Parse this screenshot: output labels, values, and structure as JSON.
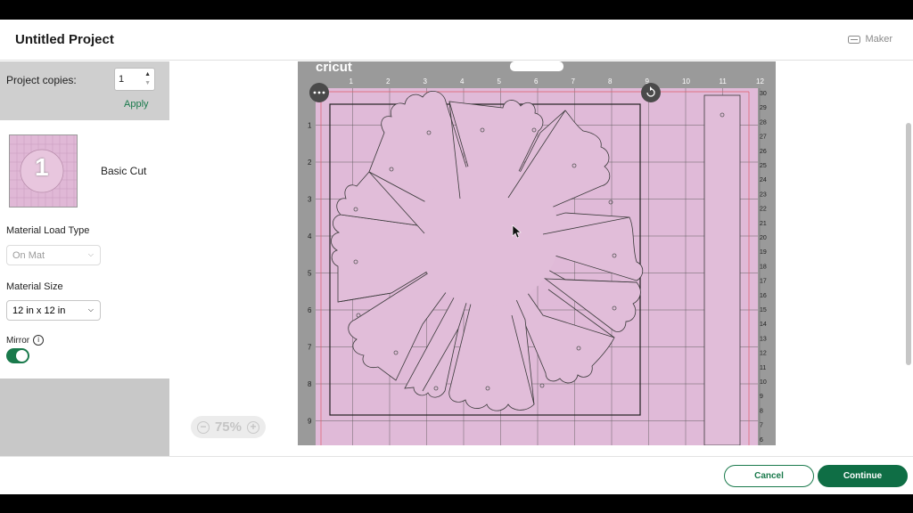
{
  "header": {
    "title": "Untitled Project",
    "device_label": "Maker"
  },
  "sidebar": {
    "copies_label": "Project copies:",
    "copies_value": "1",
    "apply_label": "Apply",
    "mat_number": "1",
    "mat_name": "Basic Cut",
    "load_type_label": "Material Load Type",
    "load_type_value": "On Mat",
    "size_label": "Material Size",
    "size_value": "12 in x 12 in",
    "mirror_label": "Mirror",
    "mirror_on": true
  },
  "mat": {
    "brand": "cricut",
    "top_ruler": [
      "1",
      "2",
      "3",
      "4",
      "5",
      "6",
      "7",
      "8",
      "9",
      "10",
      "11",
      "12"
    ],
    "left_ruler": [
      "1",
      "2",
      "3",
      "4",
      "5",
      "6",
      "7",
      "8",
      "9"
    ],
    "right_ruler": [
      "30",
      "29",
      "28",
      "27",
      "26",
      "25",
      "24",
      "23",
      "22",
      "21",
      "20",
      "19",
      "18",
      "17",
      "16",
      "15",
      "14",
      "13",
      "12",
      "11",
      "10",
      "9",
      "8",
      "7",
      "6"
    ],
    "mat_color": "#e0bad8",
    "frame_color": "#9a9a9a"
  },
  "zoom": {
    "minus": "−",
    "value": "75%",
    "plus": "+"
  },
  "footer": {
    "cancel_label": "Cancel",
    "continue_label": "Continue"
  },
  "colors": {
    "accent": "#1a7a4c",
    "primary_button": "#0f6e45"
  }
}
